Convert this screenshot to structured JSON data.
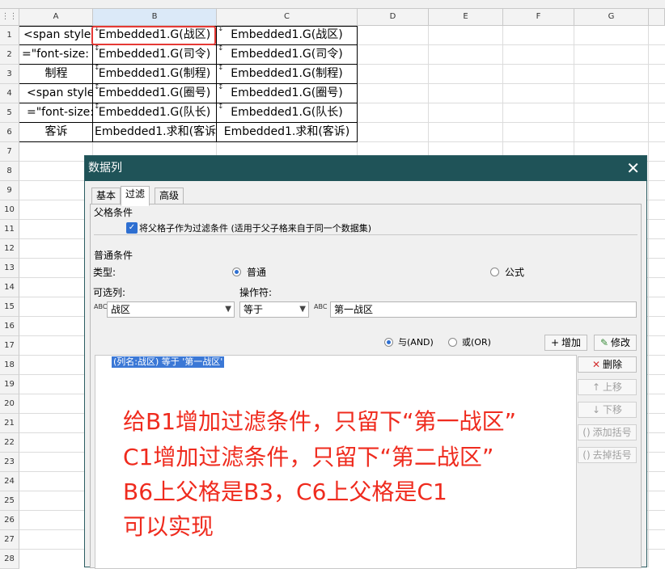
{
  "columns": [
    "A",
    "B",
    "C",
    "D",
    "E",
    "F",
    "G"
  ],
  "rows": [
    "1",
    "2",
    "3",
    "4",
    "5",
    "6",
    "7",
    "8",
    "9",
    "10",
    "11",
    "12",
    "13",
    "14",
    "15",
    "16",
    "17",
    "18",
    "19",
    "20",
    "21",
    "22",
    "23",
    "24",
    "25",
    "26",
    "27",
    "28"
  ],
  "sheet": {
    "a1": "<span style",
    "a2": "=\"font-size:",
    "a3": "制程",
    "a4": "<span style",
    "a5": "=\"font-size:",
    "a6": "客诉",
    "b1": "Embedded1.G(战区)",
    "b2": "Embedded1.G(司令)",
    "b3": "Embedded1.G(制程)",
    "b4": "Embedded1.G(圈号)",
    "b5": "Embedded1.G(队长)",
    "b6": "Embedded1.求和(客诉",
    "c1": "Embedded1.G(战区)",
    "c2": "Embedded1.G(司令)",
    "c3": "Embedded1.G(制程)",
    "c4": "Embedded1.G(圈号)",
    "c5": "Embedded1.G(队长)",
    "c6": "Embedded1.求和(客诉)",
    "expand_marker": "↕"
  },
  "dialog": {
    "title": "数据列",
    "close": "✕",
    "tabs": [
      "基本",
      "过滤",
      "高级"
    ],
    "parent_section": "父格条件",
    "parent_checkbox_label": "将父格子作为过滤条件 (适用于父子格来自于同一个数据集)",
    "normal_section": "普通条件",
    "type_label": "类型:",
    "type_normal": "普通",
    "type_formula": "公式",
    "column_label": "可选列:",
    "operator_label": "操作符:",
    "column_value": "战区",
    "operator_value": "等于",
    "value_text": "第一战区",
    "and_label": "与(AND)",
    "or_label": "或(OR)",
    "add_btn": "增加",
    "modify_btn": "修改",
    "delete_btn": "删除",
    "up_btn": "上移",
    "down_btn": "下移",
    "add_paren_btn": "添加括号",
    "remove_paren_btn": "去掉括号",
    "condition_item": "(列名:战区) 等于 '第一战区'",
    "abc_icon": "ABC"
  },
  "annotation": {
    "line1": "给B1增加过滤条件，只留下“第一战区”",
    "line2": "C1增加过滤条件，只留下“第二战区”",
    "line3": "B6上父格是B3，C6上父格是C1",
    "line4": "可以实现"
  },
  "colors": {
    "title_bar": "#1f5358",
    "annotation": "#ef2b1e",
    "highlight": "#e53935",
    "selection": "#3b78d6"
  }
}
